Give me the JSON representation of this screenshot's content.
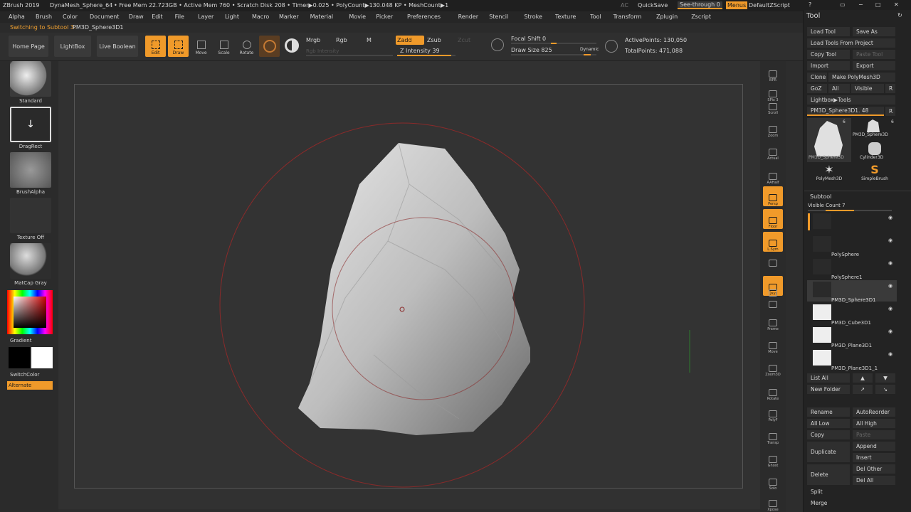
{
  "titlebar": {
    "app": "ZBrush 2019",
    "doc": "DynaMesh_Sphere_64",
    "stats": "• Free Mem 22.723GB • Active Mem 760 • Scratch Disk 208 • Timer▶0.025 • PolyCount▶130.048 KP • MeshCount▶1",
    "ac": "AC",
    "quicksave": "QuickSave",
    "seethrough": "See-through  0",
    "menus": "Menus",
    "script": "DefaultZScript"
  },
  "menubar": [
    "Alpha",
    "Brush",
    "Color",
    "Document",
    "Draw",
    "Edit",
    "File",
    "Layer",
    "Light",
    "Macro",
    "Marker",
    "Material",
    "Movie",
    "Picker",
    "Preferences",
    "Render",
    "Stencil",
    "Stroke",
    "Texture",
    "Tool",
    "Transform",
    "Zplugin",
    "Zscript"
  ],
  "status": {
    "switching": "Switching to Subtool 3:",
    "subtool": "PM3D_Sphere3D1"
  },
  "toolbar": {
    "home": "Home Page",
    "lightbox": "LightBox",
    "live_boolean": "Live Boolean",
    "edit": "Edit",
    "draw": "Draw",
    "move": "Move",
    "scale": "Scale",
    "rotate": "Rotate",
    "mrgb": "Mrgb",
    "rgb": "Rgb",
    "m": "M",
    "rgb_intensity": "Rgb Intensity",
    "zadd": "Zadd",
    "zsub": "Zsub",
    "zcut": "Zcut",
    "z_intensity": "Z Intensity 39",
    "focal_shift": "Focal Shift 0",
    "draw_size": "Draw Size 825",
    "dynamic": "Dynamic",
    "active_points": "ActivePoints: 130,050",
    "total_points": "TotalPoints: 471,088"
  },
  "leftshelf": {
    "brush": "Standard",
    "stroke": "DragRect",
    "alpha": "BrushAlpha",
    "texture": "Texture Off",
    "material": "MatCap Gray",
    "gradient": "Gradient",
    "switchcolor": "SwitchColor",
    "alternate": "Alternate"
  },
  "rightshelf": [
    "BPR",
    "SPix 3",
    "Scroll",
    "Zoom",
    "Actual",
    "AAHalf",
    "Persp",
    "Floor",
    "L.Sym",
    "",
    "Qxyz",
    "",
    "",
    "Frame",
    "Move",
    "Zoom3D",
    "Rotate",
    "PolyF",
    "Transp",
    "Ghost",
    "Solo",
    "Xpose"
  ],
  "toolpanel": {
    "title": "Tool",
    "buttons": {
      "load_tool": "Load Tool",
      "save_as": "Save As",
      "load_from_project": "Load Tools From Project",
      "copy_tool": "Copy Tool",
      "paste_tool": "Paste Tool",
      "import": "Import",
      "export": "Export",
      "clone": "Clone",
      "make_polymesh": "Make PolyMesh3D",
      "goz": "GoZ",
      "all": "All",
      "visible": "Visible",
      "r": "R",
      "lightbox_tools": "Lightbox▶Tools",
      "current": "PM3D_Sphere3D1. 48",
      "r2": "R"
    },
    "tools": [
      {
        "name": "PM3D_Sphere3D",
        "count": "6"
      },
      {
        "name": "PM3D_Sphere3D",
        "count": "6"
      },
      {
        "name": "Cylinder3D",
        "count": ""
      },
      {
        "name": "PolyMesh3D",
        "count": ""
      },
      {
        "name": "SimpleBrush",
        "count": ""
      }
    ],
    "subtool_title": "Subtool",
    "visible_count": "Visible Count 7",
    "subtools": [
      "",
      "PolySphere",
      "PolySphere1",
      "PM3D_Sphere3D1",
      "PM3D_Cube3D1",
      "PM3D_Plane3D1",
      "PM3D_Plane3D1_1"
    ],
    "list_all": "List All",
    "new_folder": "New Folder",
    "rename": "Rename",
    "autoreorder": "AutoReorder",
    "all_low": "All Low",
    "all_high": "All High",
    "copy": "Copy",
    "paste": "Paste",
    "duplicate": "Duplicate",
    "append": "Append",
    "insert": "Insert",
    "delete": "Delete",
    "del_other": "Del Other",
    "del_all": "Del All",
    "split": "Split",
    "merge": "Merge"
  },
  "colors": {
    "accent": "#f09a2a",
    "panel": "#232323",
    "canvas": "#333333"
  }
}
